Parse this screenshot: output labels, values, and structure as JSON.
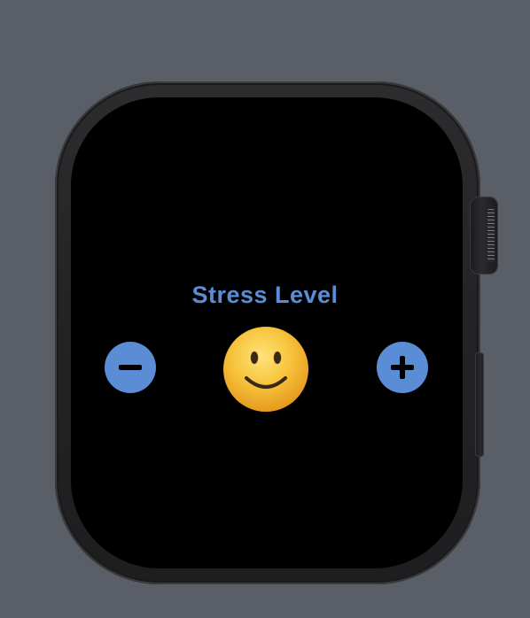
{
  "app": {
    "title": "Stress Level"
  },
  "controls": {
    "decrease_icon": "minus-icon",
    "increase_icon": "plus-icon"
  },
  "mood": {
    "icon": "slightly-smiling-face-emoji"
  },
  "colors": {
    "accent": "#5b8dd6",
    "screen": "#000000",
    "background": "#5a5e66",
    "emoji_fill": "#f7c23a"
  }
}
